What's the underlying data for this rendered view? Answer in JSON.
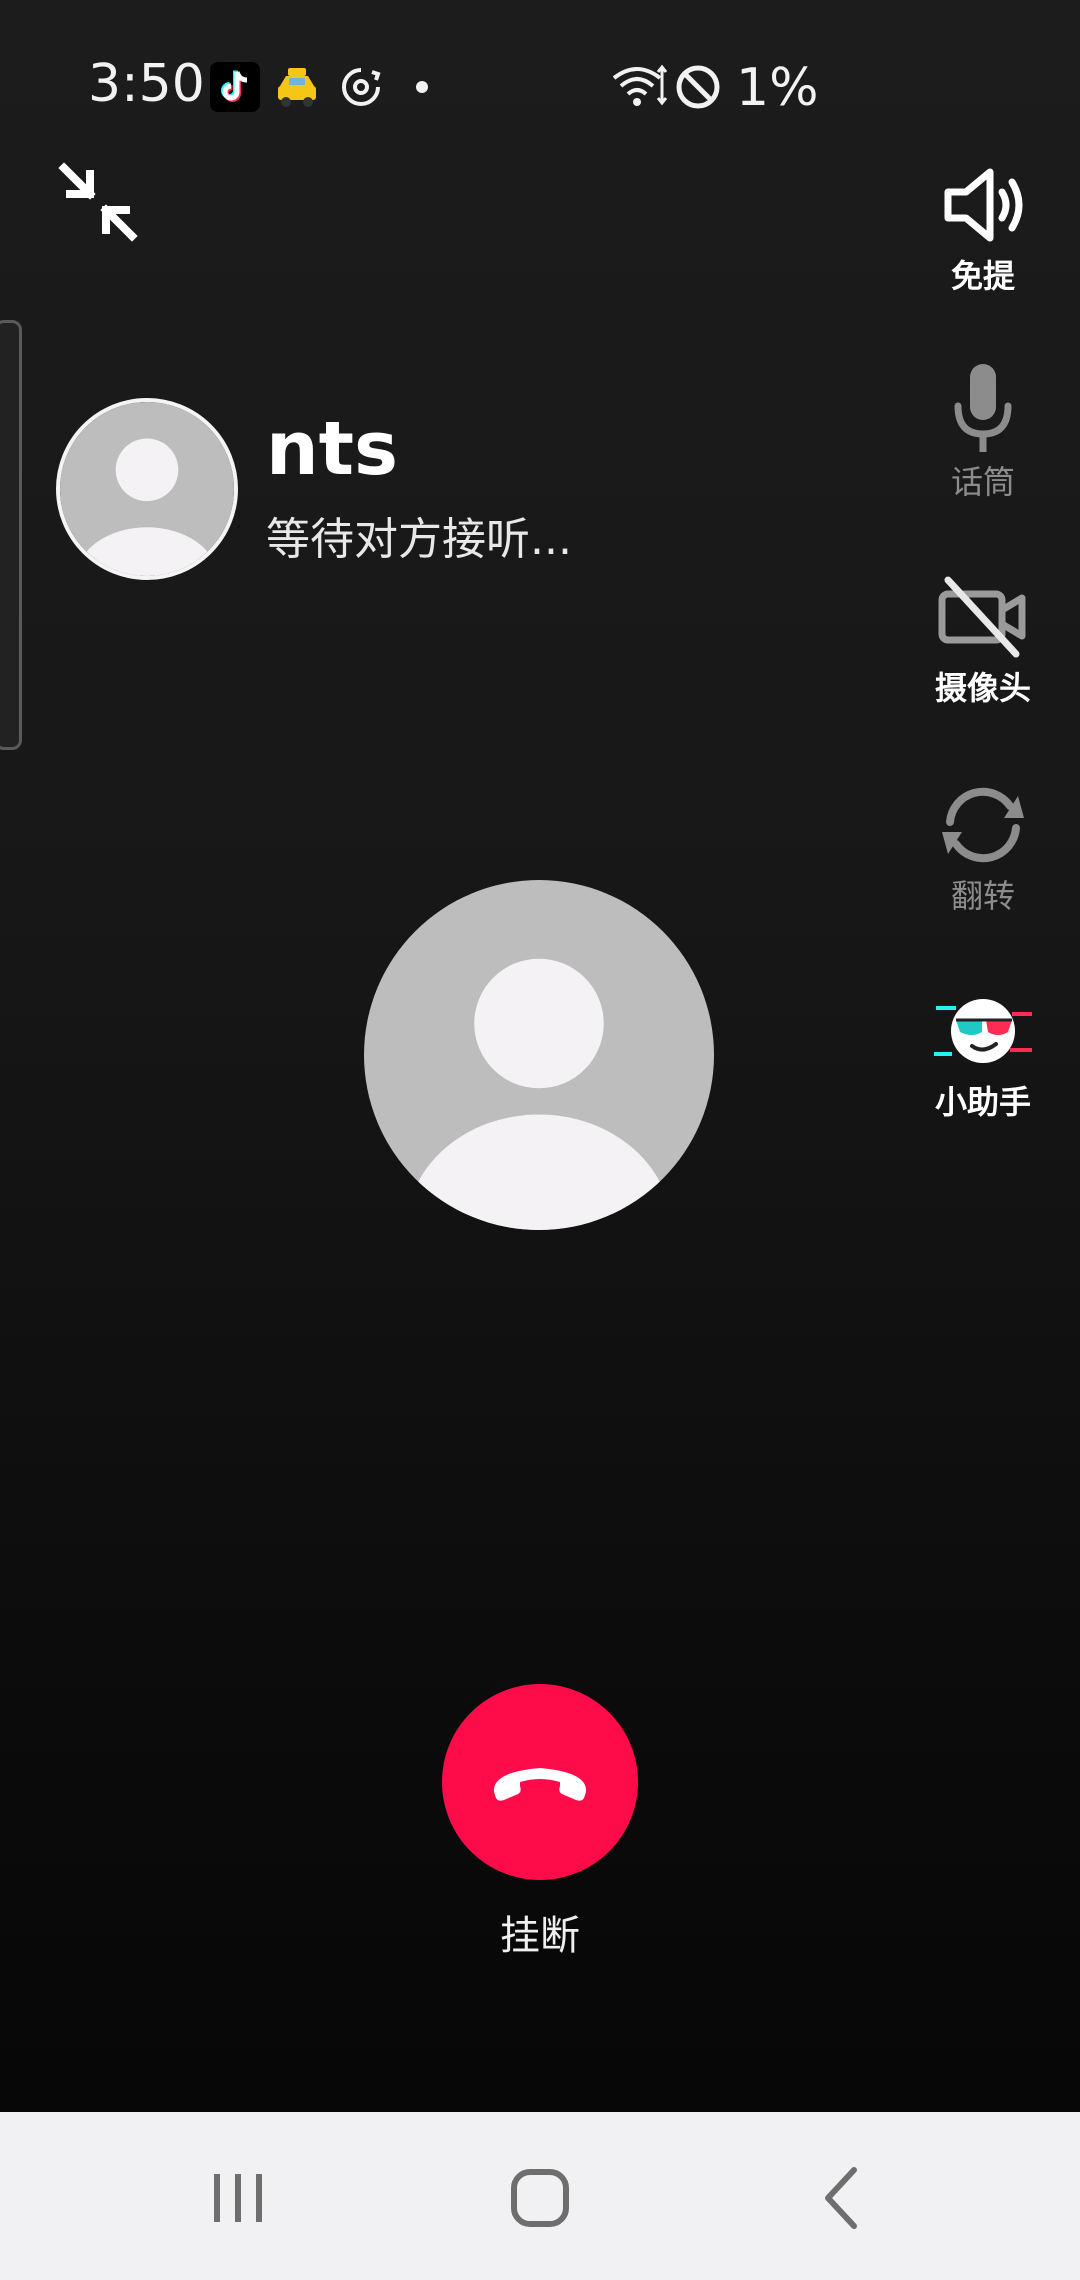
{
  "status_bar": {
    "time": "3:50",
    "battery": "1%",
    "icons": [
      "tiktok-icon",
      "taxi-icon",
      "sync-icon",
      "dot-icon",
      "wifi-icon",
      "do-not-disturb-icon"
    ]
  },
  "caller": {
    "name": "nts",
    "status": "等待对方接听..."
  },
  "controls": {
    "speaker": "免提",
    "mic": "话筒",
    "camera": "摄像头",
    "flip": "翻转",
    "assistant": "小助手"
  },
  "hangup": {
    "label": "挂断"
  },
  "colors": {
    "hangup": "#fe0b4a",
    "avatar_bg": "#bdbdbd",
    "avatar_figure": "#f4f2f5",
    "nav_bg": "#f1f0f3"
  }
}
